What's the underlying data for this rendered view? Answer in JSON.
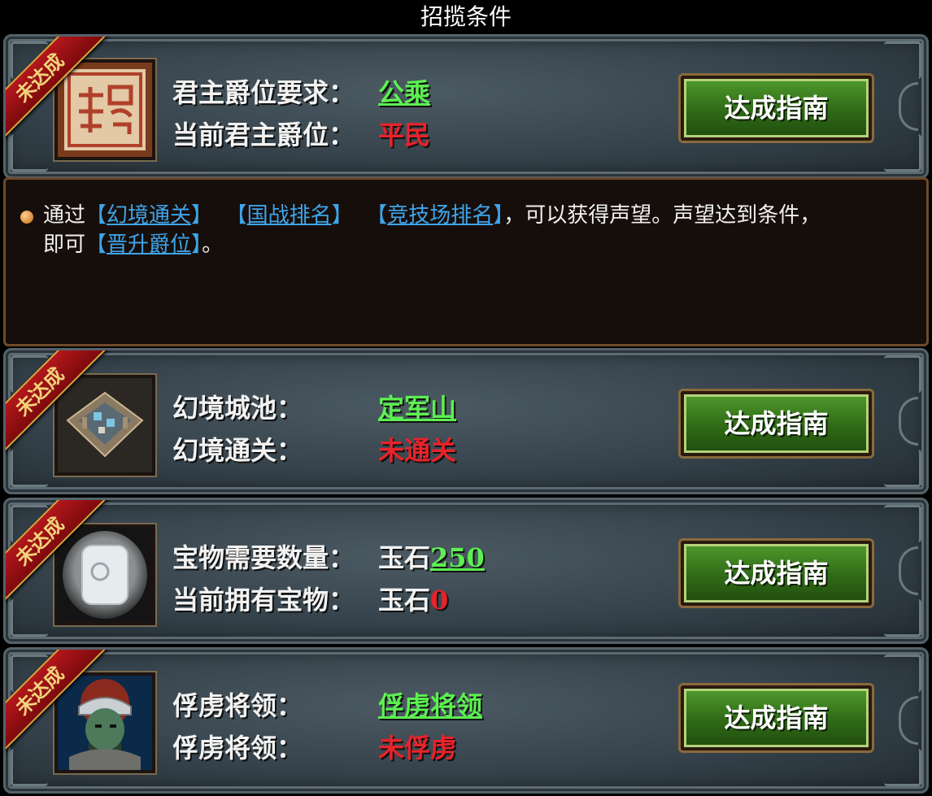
{
  "title": "招揽条件",
  "ribbon_label": "未达成",
  "guide_button_label": "达成指南",
  "info": {
    "prefix": "通过",
    "links": [
      "幻境通关",
      "国战排名",
      "竞技场排名",
      "晋升爵位"
    ],
    "middle": "，可以获得声望。声望达到条件，",
    "line2_prefix": "即可",
    "suffix": "。"
  },
  "conditions": [
    {
      "icon": "seal-icon",
      "row1_label": "君主爵位要求：",
      "row1_value": "公乘",
      "row2_label": "当前君主爵位：",
      "row2_value": "平民"
    },
    {
      "icon": "city-icon",
      "row1_label": "幻境城池：",
      "row1_value": "定军山",
      "row2_label": "幻境通关：",
      "row2_value": "未通关"
    },
    {
      "icon": "jade-stone-icon",
      "row1_label": "宝物需要数量：",
      "row1_value_prefix": "玉石",
      "row1_value": "250",
      "row2_label": "当前拥有宝物：",
      "row2_value_prefix": "玉石",
      "row2_value": "0"
    },
    {
      "icon": "general-portrait-icon",
      "row1_label": "俘虏将领：",
      "row1_value": "俘虏将领",
      "row2_label": "俘虏将领：",
      "row2_value": "未俘虏"
    }
  ]
}
